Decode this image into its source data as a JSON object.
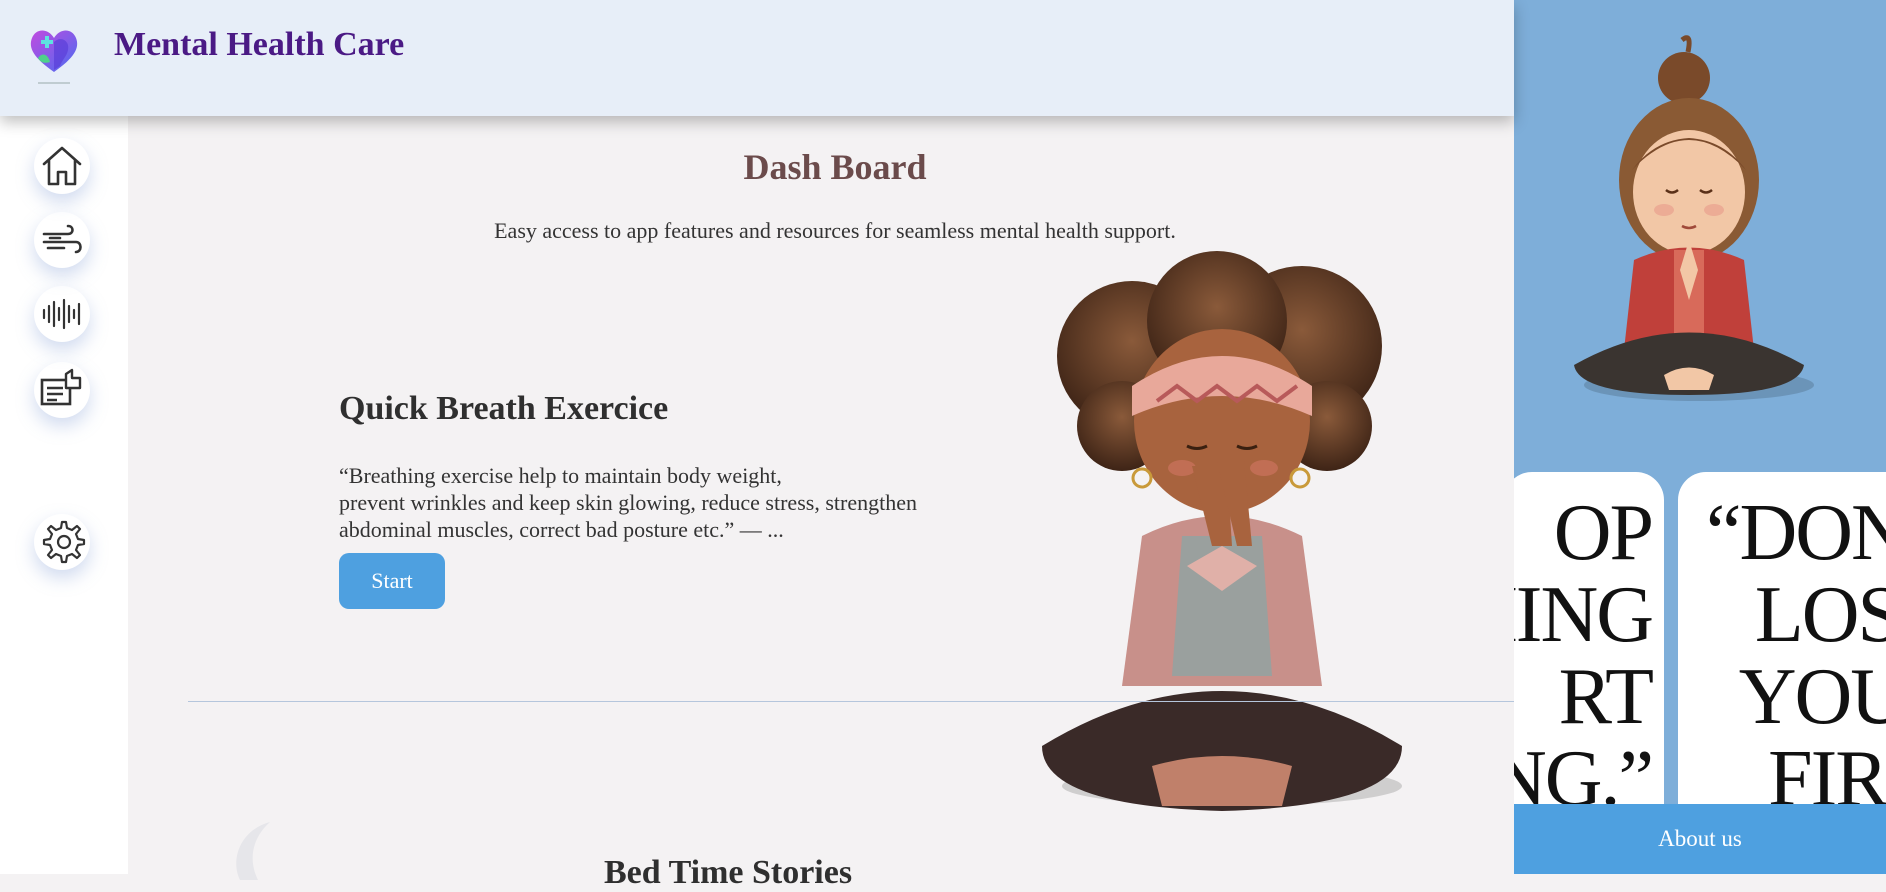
{
  "header": {
    "title": "Mental Health Care",
    "logo_icon": "heart-head-logo"
  },
  "sidebar": {
    "items": [
      {
        "icon": "home-icon"
      },
      {
        "icon": "wind-icon"
      },
      {
        "icon": "audio-wave-icon"
      },
      {
        "icon": "feedback-icon"
      },
      {
        "icon": "gear-icon"
      }
    ]
  },
  "main": {
    "title": "Dash Board",
    "subtitle": "Easy access to app features and resources for seamless mental health support.",
    "quick_breath": {
      "title": "Quick Breath Exercice",
      "quote_lines": [
        "“Breathing exercise help to maintain body weight,",
        "prevent wrinkles and keep skin glowing, reduce stress, strengthen",
        "abdominal muscles, correct bad posture etc.” — ..."
      ],
      "start_label": "Start"
    },
    "bedtime": {
      "title": "Bed Time Stories"
    }
  },
  "right_panel": {
    "quote_card_1_lines": [
      "OP",
      "HING",
      "RT",
      "NG.”"
    ],
    "quote_card_2_lines": [
      "“DON",
      "LOS",
      "YOU",
      "FIR"
    ],
    "about_label": "About us"
  },
  "colors": {
    "header_bg": "#e7eef8",
    "title_purple": "#4b1a85",
    "accent_blue": "#4ea0e0",
    "right_panel_bg": "#7eaed9",
    "page_bg": "#f4f2f3"
  }
}
